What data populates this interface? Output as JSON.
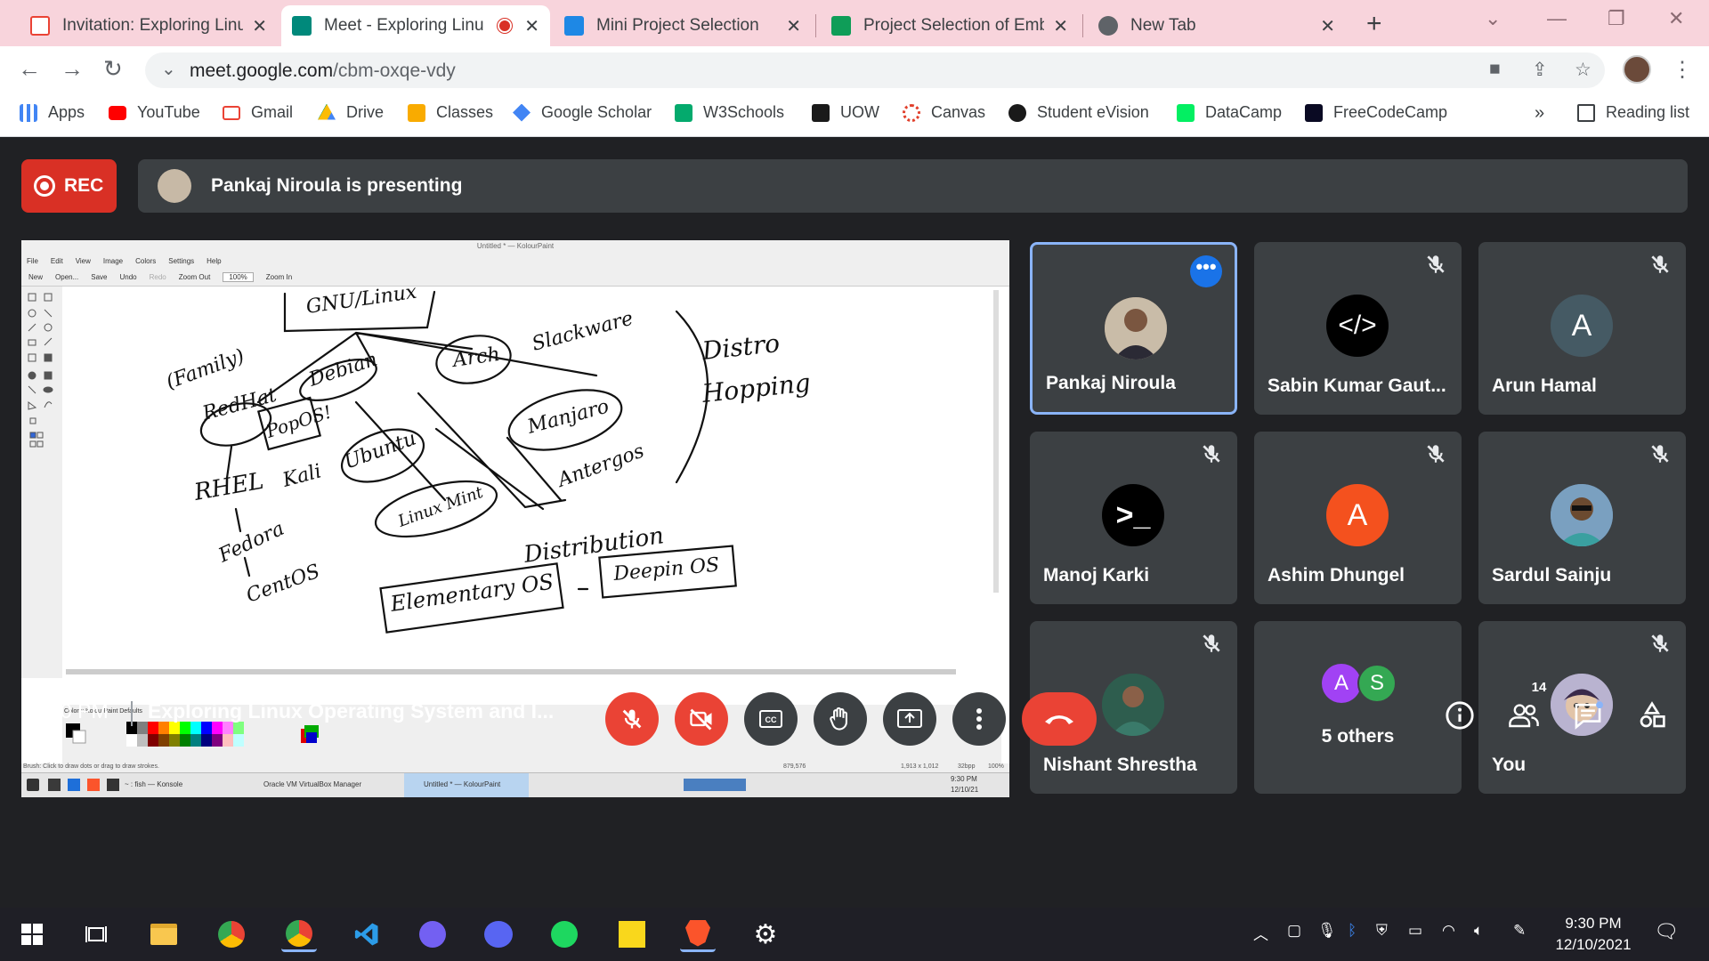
{
  "tabs": [
    {
      "title": "Invitation: Exploring Linux",
      "favicon": "gmail-icon"
    },
    {
      "title": "Meet - Exploring Linu",
      "favicon": "meet-icon",
      "active": true
    },
    {
      "title": "Mini Project Selection",
      "favicon": "classroom-icon"
    },
    {
      "title": "Project Selection of Embe",
      "favicon": "sheets-icon"
    },
    {
      "title": "New Tab",
      "favicon": "chrome-icon"
    }
  ],
  "omnibox": {
    "url_host": "meet.google.com",
    "url_path": "/cbm-oxqe-vdy"
  },
  "bookmarks": [
    {
      "label": "Apps",
      "icon": "apps-grid-icon",
      "color": "#4285f4"
    },
    {
      "label": "YouTube",
      "icon": "youtube-icon",
      "color": "#ff0000"
    },
    {
      "label": "Gmail",
      "icon": "gmail-icon",
      "color": "#ea4335"
    },
    {
      "label": "Drive",
      "icon": "drive-icon",
      "color": "#fbbc04"
    },
    {
      "label": "Classes",
      "icon": "classroom-icon",
      "color": "#f9ab00"
    },
    {
      "label": "Google Scholar",
      "icon": "scholar-icon",
      "color": "#4285f4"
    },
    {
      "label": "W3Schools",
      "icon": "w3schools-icon",
      "color": "#04aa6d"
    },
    {
      "label": "UOW",
      "icon": "uow-icon",
      "color": "#1a1a1a"
    },
    {
      "label": "Canvas",
      "icon": "canvas-icon",
      "color": "#e13f2b"
    },
    {
      "label": "Student eVision",
      "icon": "evision-icon",
      "color": "#1a1a1a"
    },
    {
      "label": "DataCamp",
      "icon": "datacamp-icon",
      "color": "#03ef62"
    },
    {
      "label": "FreeCodeCamp",
      "icon": "freecodecamp-icon",
      "color": "#0a0a23"
    }
  ],
  "bookmarks_overflow": "»",
  "reading_list": "Reading list",
  "rec_label": "REC",
  "presenting_text": "Pankaj Niroula is presenting",
  "kolourpaint": {
    "title": "Untitled * — KolourPaint",
    "menu": [
      "File",
      "Edit",
      "View",
      "Image",
      "Colors",
      "Settings",
      "Help"
    ],
    "toolbar": [
      "New",
      "Open...",
      "Save",
      "Undo",
      "Redo",
      "Zoom Out",
      "100%",
      "Zoom In"
    ],
    "colors_label": "Colors: KolourPaint Defaults",
    "status_left": "Brush: Click to draw dots or drag to draw strokes.",
    "status_pos": "879,576",
    "status_size": "1,913 x 1,012",
    "status_bpp": "32bpp",
    "status_zoom": "100%",
    "task_konsole": "~ : fish — Konsole",
    "task_vbox": "Oracle VM VirtualBox Manager",
    "task_kp": "Untitled * — KolourPaint",
    "task_time": "9:30 PM",
    "task_date": "12/10/21",
    "drawing_text": [
      "GNU/Linux",
      "(Family)",
      "RedHat",
      "PopOS!",
      "Debian",
      "Arch",
      "Slackware",
      "Distro",
      "Hopping",
      "Manjaro",
      "Antergos",
      "RHEL",
      "Kali",
      "Ubuntu",
      "Fedora",
      "Linux Mint",
      "CentOS",
      "Distribution",
      "Elementary OS",
      "Deepin OS"
    ]
  },
  "participants": [
    {
      "name": "Pankaj Niroula",
      "avatar": "photo",
      "color": "#8a6e5a",
      "muted": false,
      "active": true
    },
    {
      "name": "Sabin Kumar Gaut...",
      "avatar_text": "</>",
      "color": "#000000",
      "muted": true
    },
    {
      "name": "Arun Hamal",
      "avatar_text": "A",
      "color": "#455a64",
      "muted": true
    },
    {
      "name": "Manoj Karki",
      "avatar_text": ">_",
      "color": "#000000",
      "muted": true
    },
    {
      "name": "Ashim Dhungel",
      "avatar_text": "A",
      "color": "#f4511e",
      "muted": true
    },
    {
      "name": "Sardul Sainju",
      "avatar": "photo",
      "color": "#5a7fa0",
      "muted": true
    },
    {
      "name": "Nishant Shrestha",
      "avatar": "photo",
      "color": "#2e5d4e",
      "muted": true
    },
    {
      "name": "5 others",
      "others": true,
      "a": "A",
      "s": "S",
      "a_color": "#a142f4",
      "s_color": "#34a853"
    },
    {
      "name": "You",
      "avatar": "photo",
      "color": "#7a6e9a",
      "muted": true
    }
  ],
  "meeting": {
    "time": "9:30 PM",
    "title": "Exploring Linux Operating System and I..."
  },
  "people_count": "14",
  "taskbar": {
    "time": "9:30 PM",
    "date": "12/10/2021"
  }
}
